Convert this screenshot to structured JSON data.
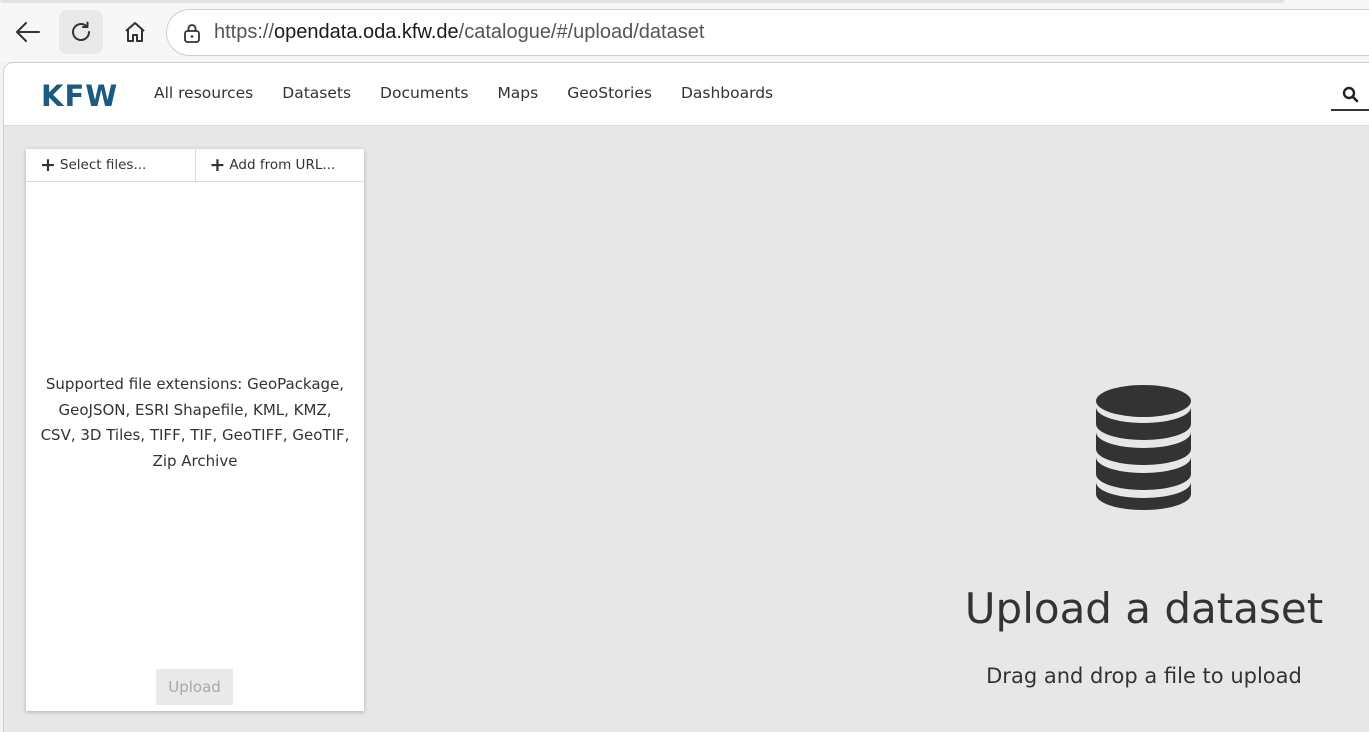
{
  "browser": {
    "url_protocol": "https://",
    "url_host": "opendata.oda.kfw.de",
    "url_path": "/catalogue/#/upload/dataset"
  },
  "header": {
    "logo_text": "KFW",
    "nav": [
      {
        "label": "All resources"
      },
      {
        "label": "Datasets"
      },
      {
        "label": "Documents"
      },
      {
        "label": "Maps"
      },
      {
        "label": "GeoStories"
      },
      {
        "label": "Dashboards"
      }
    ]
  },
  "panel": {
    "select_files_label": "Select files...",
    "add_url_label": "Add from URL...",
    "supported_text": "Supported file extensions: GeoPackage, GeoJSON, ESRI Shapefile, KML, KMZ, CSV, 3D Tiles, TIFF, TIF, GeoTIFF, GeoTIF, Zip Archive",
    "upload_label": "Upload"
  },
  "dropzone": {
    "title": "Upload a dataset",
    "subtitle": "Drag and drop a file to upload"
  },
  "icons": {
    "back": "arrow-left-icon",
    "reload": "reload-icon",
    "home": "home-icon",
    "lock": "lock-icon",
    "search": "search-icon",
    "database": "database-icon"
  },
  "colors": {
    "brand": "#1b5a83",
    "text": "#333333",
    "page_bg": "#e7e7e7"
  }
}
